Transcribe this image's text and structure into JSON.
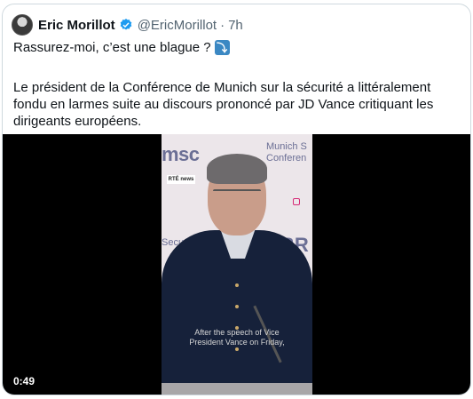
{
  "tweet": {
    "author_name": "Eric Morillot",
    "handle": "@EricMorillot",
    "separator": "·",
    "time_ago": "7h",
    "line1": "Rassurez-moi, c’est une blague ?",
    "emoji": "⤵",
    "body": "Le président de la Conférence de Munich sur la sécurité a littéralement fondu en larmes suite au discours prononcé par JD Vance critiquant les dirigeants européens."
  },
  "video": {
    "logo_text": "msc",
    "munich_text_1": "Munich S",
    "munich_text_2": "Conferen",
    "security_text": "Securit",
    "br_text": "BR",
    "badge_text": "RTÉ news",
    "subtitle_line1": "After the speech of Vice",
    "subtitle_line2": "President Vance on Friday,",
    "duration": "0:49"
  },
  "colors": {
    "verified": "#1d9bf0",
    "handle_gray": "#536471",
    "border": "#cfd9de"
  }
}
